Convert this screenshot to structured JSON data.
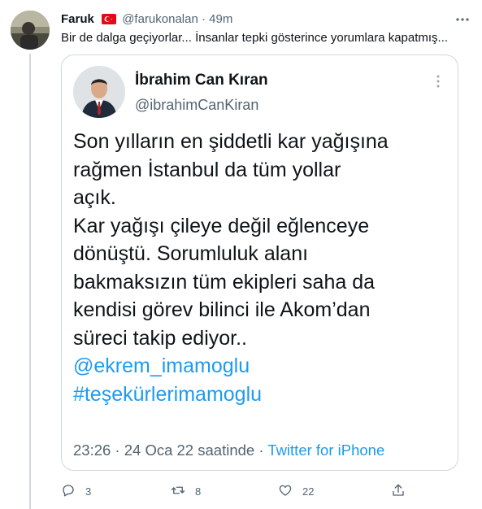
{
  "tweet": {
    "author_name": "Faruk",
    "author_handle": "@farukonalan",
    "separator": "·",
    "time_ago": "49m",
    "text": "Bir de dalga geçiyorlar... İnsanlar tepki gösterince yorumlara kapatmış...",
    "flag": "turkey-flag"
  },
  "quoted": {
    "name": "İbrahim Can Kıran",
    "handle": "@ibrahimCanKiran",
    "lines": [
      "Son yılların en şiddetli kar yağışına",
      "rağmen İstanbul da tüm yollar",
      "açık.",
      "Kar yağışı çileye değil eğlenceye",
      "dönüştü. Sorumluluk alanı",
      "bakmaksızın tüm ekipleri saha da",
      "kendisi görev bilinci ile Akom’dan",
      "süreci takip ediyor.."
    ],
    "mention": "@ekrem_imamoglu",
    "hashtag": "#teşekürlerimamoglu",
    "timestamp": "23:26 · 24 Oca 22 saatinde ·",
    "source": "Twitter for iPhone"
  },
  "actions": {
    "reply_count": "3",
    "retweet_count": "8",
    "like_count": "22"
  },
  "colors": {
    "link": "#1d9bf0",
    "secondary_text": "#536471",
    "border": "#cfd9de"
  }
}
